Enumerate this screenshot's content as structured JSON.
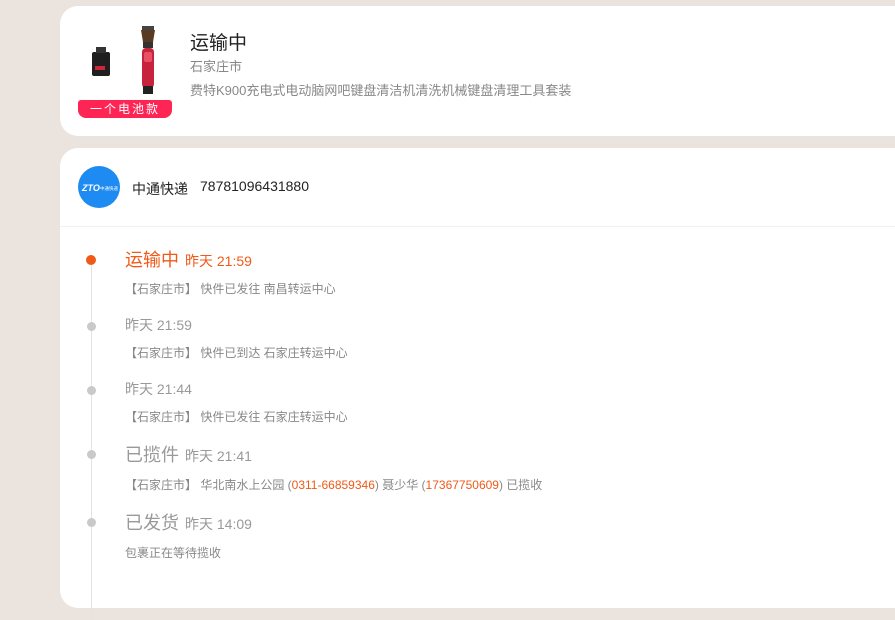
{
  "product": {
    "status": "运输中",
    "city": "石家庄市",
    "name": "费特K900充电式电动脑网吧键盘清洁机清洗机械键盘清理工具套装",
    "banner": "一个电池款"
  },
  "carrier": {
    "logo_text": "ZTO",
    "logo_sub": "中通快递",
    "name": "中通快递",
    "tracking_number": "78781096431880"
  },
  "colors": {
    "accent": "#ef5a18",
    "banner": "#fe2554",
    "carrier_blue": "#1d8bf1"
  },
  "events": [
    {
      "status": "运输中",
      "time": "昨天 21:59",
      "desc": "【石家庄市】 快件已发往 南昌转运中心",
      "active": true
    },
    {
      "status": "",
      "time": "昨天 21:59",
      "desc": "【石家庄市】 快件已到达 石家庄转运中心"
    },
    {
      "status": "",
      "time": "昨天 21:44",
      "desc": "【石家庄市】 快件已发往 石家庄转运中心"
    },
    {
      "status": "已揽件",
      "time": "昨天 21:41",
      "desc_pre": "【石家庄市】 华北南水上公园 (",
      "phone1": "0311-66859346",
      "desc_mid": ") 聂少华 (",
      "phone2": "17367750609",
      "desc_post": ") 已揽收"
    },
    {
      "status": "已发货",
      "time": "昨天 14:09",
      "desc": "包裹正在等待揽收"
    }
  ]
}
